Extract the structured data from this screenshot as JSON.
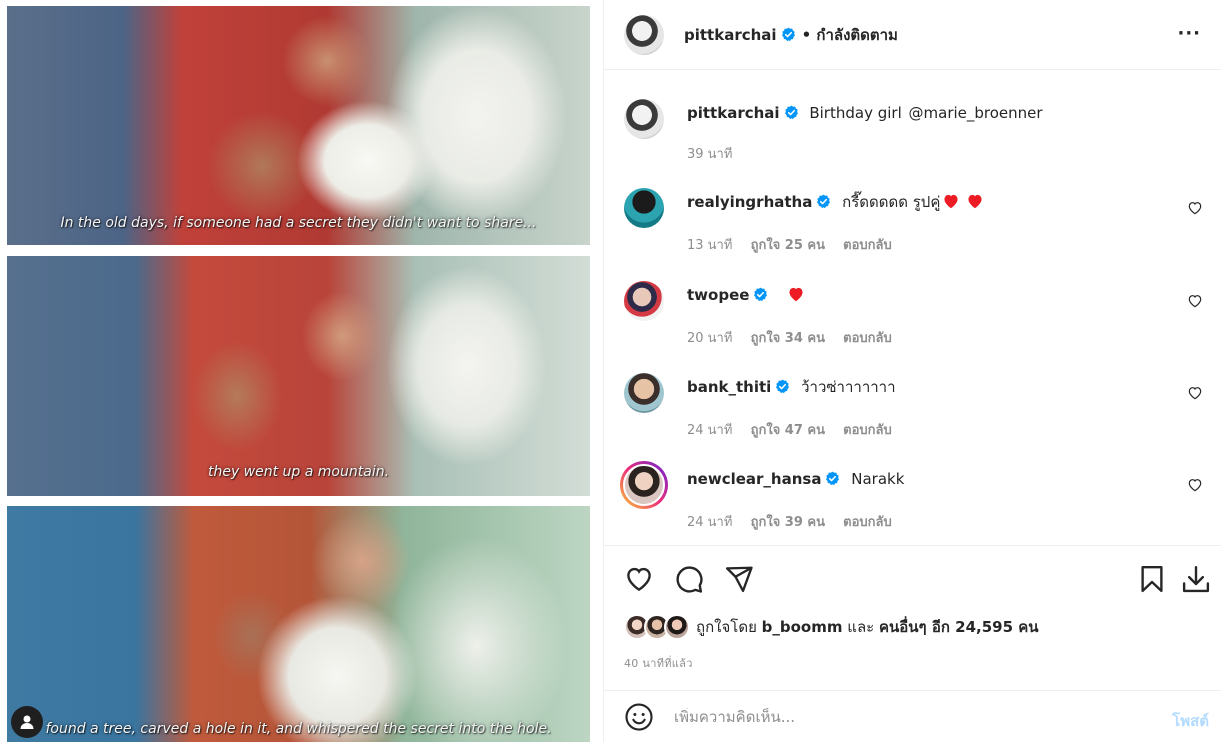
{
  "media": {
    "captions": [
      "In the old days, if someone had a secret they didn't want to share...",
      "they went up a mountain.",
      "found a tree, carved a hole in it, and whispered the secret into the hole."
    ]
  },
  "header": {
    "username": "pittkarchai",
    "follow_status": "• กำลังติดตาม",
    "more_icon": "···"
  },
  "caption": {
    "username": "pittkarchai",
    "text": "Birthday girl",
    "mention": "@marie_broenner",
    "time": "39 นาที"
  },
  "comments": [
    {
      "username": "realyingrhatha",
      "text": "กรี๊ดดดดด รูปคู่",
      "hearts": 2,
      "time": "13 นาที",
      "likes": "ถูกใจ 25 คน",
      "reply": "ตอบกลับ"
    },
    {
      "username": "twopee",
      "text": "",
      "hearts": 1,
      "time": "20 นาที",
      "likes": "ถูกใจ 34 คน",
      "reply": "ตอบกลับ"
    },
    {
      "username": "bank_thiti",
      "text": "ว้าวซ่าาาาาาา",
      "hearts": 0,
      "time": "24 นาที",
      "likes": "ถูกใจ 47 คน",
      "reply": "ตอบกลับ"
    },
    {
      "username": "newclear_hansa",
      "text": "Narakk",
      "hearts": 0,
      "time": "24 นาที",
      "likes": "ถูกใจ 39 คน",
      "reply": "ตอบกลับ"
    }
  ],
  "likes": {
    "prefix": "ถูกใจโดย",
    "by": "b_boomm",
    "and": "และ",
    "others": "คนอื่นๆ อีก 24,595 คน"
  },
  "posted_ago": "40 นาทีที่แล้ว",
  "composer": {
    "placeholder": "เพิ่มความคิดเห็น...",
    "post_label": "โพสต์"
  },
  "colors": {
    "verified": "#0095f6",
    "heart": "#ed4956",
    "post_disabled": "#b3dbff"
  }
}
